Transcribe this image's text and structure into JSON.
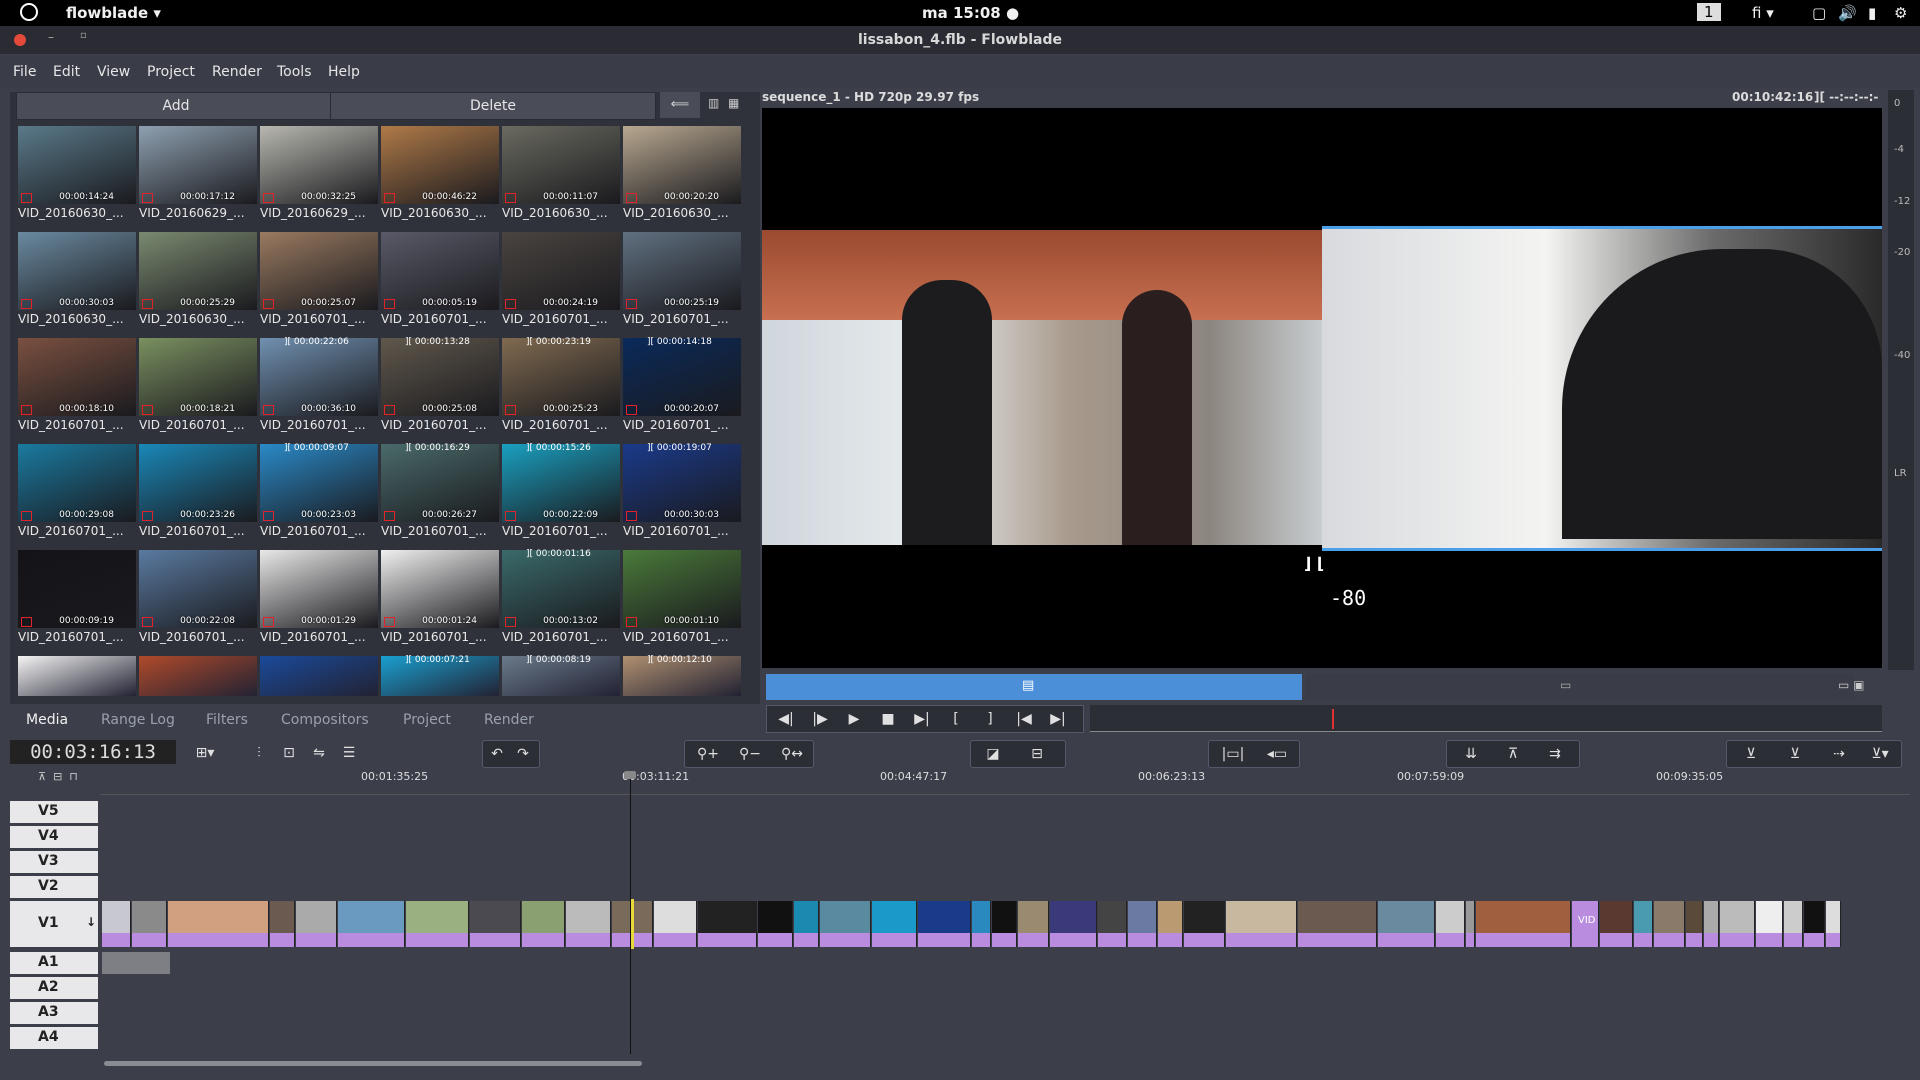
{
  "system": {
    "app_menu": "flowblade ▾",
    "clock": "ma 15:08 ●",
    "workspace": "1",
    "lang": "fi ▾"
  },
  "window": {
    "title": "lissabon_4.flb - Flowblade"
  },
  "menu": [
    "File",
    "Edit",
    "View",
    "Project",
    "Render",
    "Tools",
    "Help"
  ],
  "media": {
    "add_label": "Add",
    "delete_label": "Delete",
    "items": [
      {
        "name": "VID_20160630_...",
        "tc": "00:00:14:24",
        "c": "#5a7a8a"
      },
      {
        "name": "VID_20160629_...",
        "tc": "00:00:17:12",
        "c": "#8ea0b0"
      },
      {
        "name": "VID_20160629_...",
        "tc": "00:00:32:25",
        "c": "#b8b8b0"
      },
      {
        "name": "VID_20160630_...",
        "tc": "00:00:46:22",
        "c": "#b07a48"
      },
      {
        "name": "VID_20160630_...",
        "tc": "00:00:11:07",
        "c": "#6a6a60"
      },
      {
        "name": "VID_20160630_...",
        "tc": "00:00:20:20",
        "c": "#b8a890"
      },
      {
        "name": "VID_20160630_...",
        "tc": "00:00:30:03",
        "c": "#6a8aa0"
      },
      {
        "name": "VID_20160630_...",
        "tc": "00:00:25:29",
        "c": "#7a8a70"
      },
      {
        "name": "VID_20160701_...",
        "tc": "00:00:25:07",
        "c": "#9a7a60"
      },
      {
        "name": "VID_20160701_...",
        "tc": "00:00:05:19",
        "c": "#5a5a68"
      },
      {
        "name": "VID_20160701_...",
        "tc": "00:00:24:19",
        "c": "#4a4440"
      },
      {
        "name": "VID_20160701_...",
        "tc": "00:00:25:19",
        "c": "#607080"
      },
      {
        "name": "VID_20160701_...",
        "tc": "00:00:18:10",
        "c": "#7a5040"
      },
      {
        "name": "VID_20160701_...",
        "tc": "00:00:18:21",
        "c": "#7a9060"
      },
      {
        "name": "VID_20160701_...",
        "tc": "00:00:36:10",
        "c": "#7090b0"
      },
      {
        "name": "VID_20160701_...",
        "tc": "00:00:25:08",
        "c": "#60584c"
      },
      {
        "name": "VID_20160701_...",
        "tc": "00:00:25:23",
        "c": "#806a50"
      },
      {
        "name": "VID_20160701_...",
        "tc": "00:00:20:07",
        "c": "#0a2a5a"
      },
      {
        "name": "VID_20160701_...",
        "tc": "00:00:29:08",
        "c": "#1a7aa0"
      },
      {
        "name": "VID_20160701_...",
        "tc": "00:00:23:26",
        "c": "#1a88b8"
      },
      {
        "name": "VID_20160701_...",
        "tc": "00:00:23:03",
        "c": "#2a8ac8"
      },
      {
        "name": "VID_20160701_...",
        "tc": "00:00:26:27",
        "c": "#4a6a6a"
      },
      {
        "name": "VID_20160701_...",
        "tc": "00:00:22:09",
        "c": "#1aa0c0"
      },
      {
        "name": "VID_20160701_...",
        "tc": "00:00:30:03",
        "c": "#1a3a8a"
      },
      {
        "name": "VID_20160701_...",
        "tc": "00:00:09:19",
        "c": "#141418"
      },
      {
        "name": "VID_20160701_...",
        "tc": "00:00:22:08",
        "c": "#5a7aa0"
      },
      {
        "name": "VID_20160701_...",
        "tc": "00:00:01:29",
        "c": "#e8e8e8"
      },
      {
        "name": "VID_20160701_...",
        "tc": "00:00:01:24",
        "c": "#f0f0f0"
      },
      {
        "name": "VID_20160701_...",
        "tc": "00:00:13:02",
        "c": "#3a6a6a"
      },
      {
        "name": "VID_20160701_...",
        "tc": "00:00:01:10",
        "c": "#4a7a3a"
      }
    ],
    "partial_tcs": [
      "00:00:07:21",
      "00:00:08:19",
      "00:00:12:10"
    ],
    "upper_tcs": [
      "00:00:22:06",
      "00:00:13:28",
      "00:00:23:19",
      "00:00:14:18",
      "00:00:09:07",
      "00:00:16:29",
      "00:00:15:26",
      "00:00:19:07",
      "00:00:01:16"
    ]
  },
  "tabs": [
    "Media",
    "Range Log",
    "Filters",
    "Compositors",
    "Project",
    "Render"
  ],
  "monitor": {
    "sequence_info": "sequence_1  -  HD 720p 29.97 fps",
    "timecode": "00:10:42:16",
    "mark_info": "][ --:--:--:--",
    "level_value": "-80",
    "scale": [
      "0",
      "-4",
      "-12",
      "-20",
      "-40",
      "LR"
    ]
  },
  "timeline": {
    "current_tc": "00:03:16:13",
    "ruler": [
      "00:01:35:25",
      "00:03:11:21",
      "00:04:47:17",
      "00:06:23:13",
      "00:07:59:09",
      "00:09:35:05"
    ],
    "video_tracks": [
      "V5",
      "V4",
      "V3",
      "V2",
      "V1"
    ],
    "audio_tracks": [
      "A1",
      "A2",
      "A3",
      "A4"
    ],
    "clip_label": "VID"
  },
  "colors": {
    "accent": "#4a8fd8",
    "clip": "#b98ce0",
    "playhead": "#e8d83a",
    "bg": "#3c3f4a"
  }
}
